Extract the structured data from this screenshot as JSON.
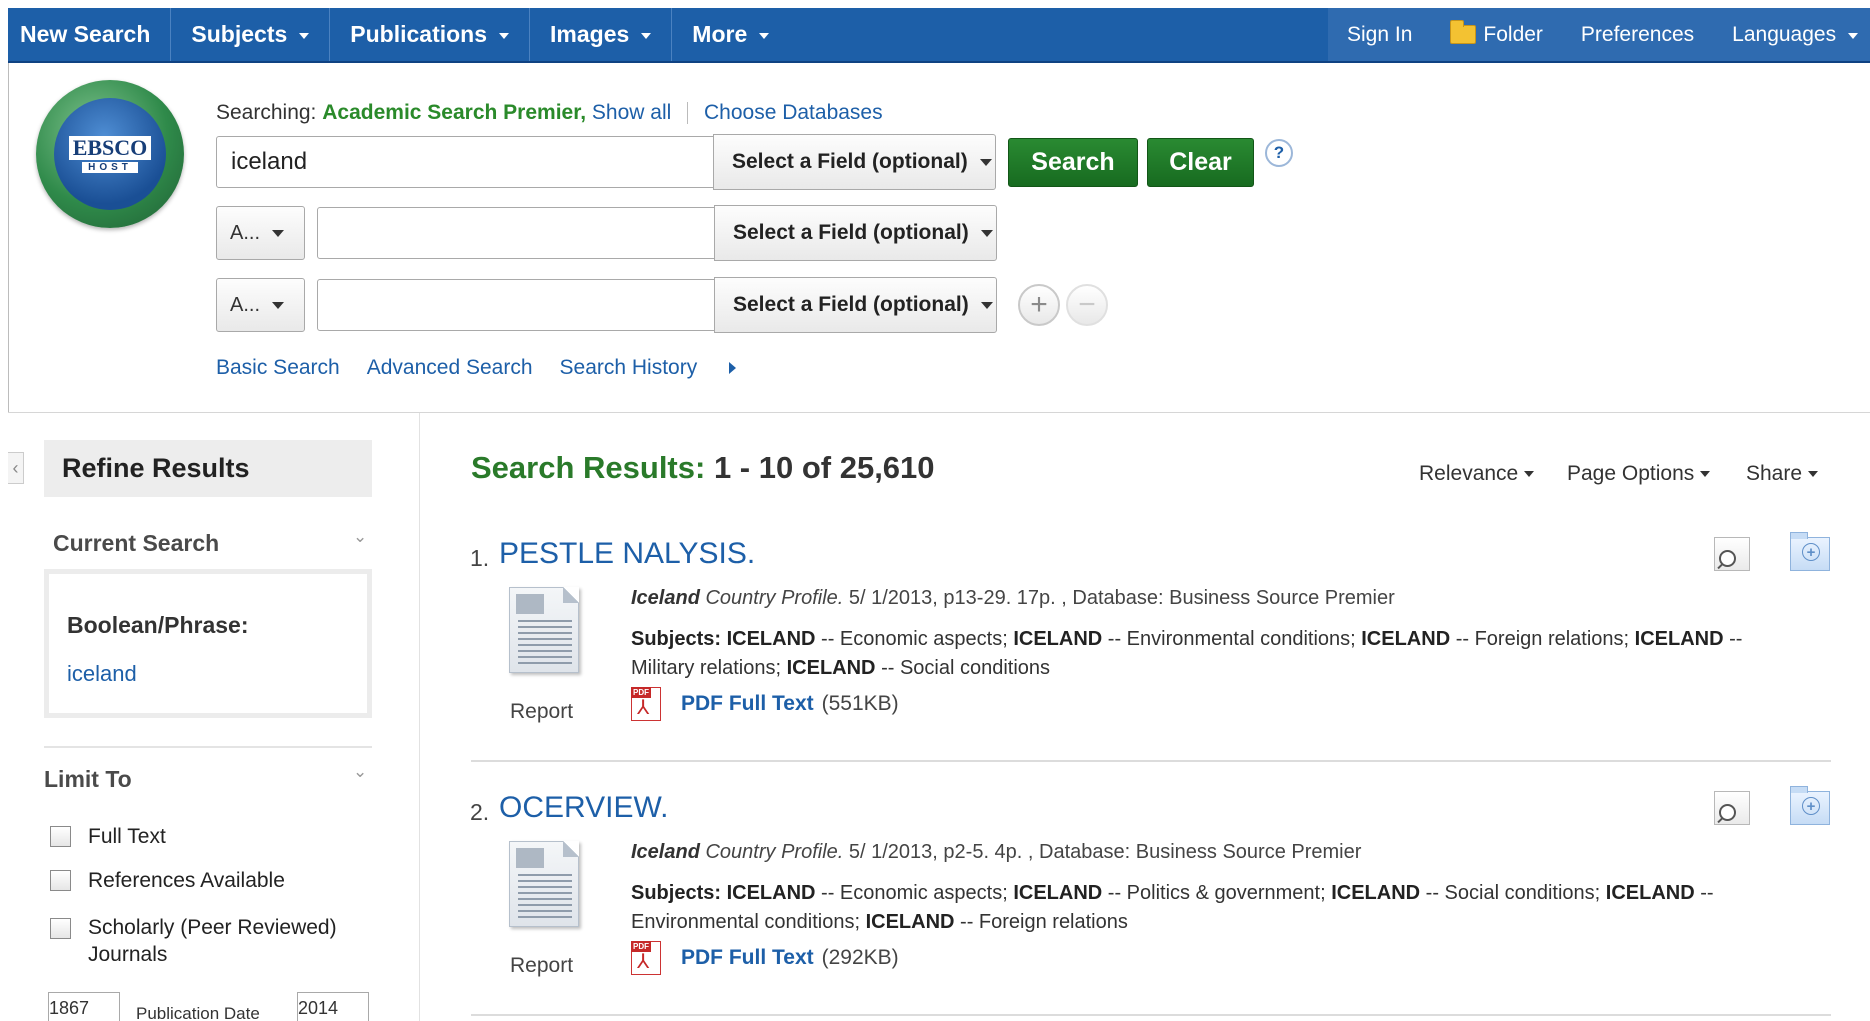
{
  "nav": {
    "items": [
      {
        "label": "New Search",
        "dropdown": false
      },
      {
        "label": "Subjects",
        "dropdown": true
      },
      {
        "label": "Publications",
        "dropdown": true
      },
      {
        "label": "Images",
        "dropdown": true
      },
      {
        "label": "More",
        "dropdown": true
      }
    ],
    "utility": {
      "sign_in": "Sign In",
      "folder": "Folder",
      "preferences": "Preferences",
      "languages": "Languages"
    }
  },
  "logo": {
    "word": "EBSCO",
    "sub": "HOST"
  },
  "search": {
    "searching_label": "Searching:",
    "database": "Academic Search Premier,",
    "show_all": "Show all",
    "choose_databases": "Choose Databases",
    "rows": [
      {
        "value": "iceland",
        "field": "Select a Field (optional)"
      },
      {
        "operator": "A...",
        "value": "",
        "field": "Select a Field (optional)"
      },
      {
        "operator": "A...",
        "value": "",
        "field": "Select a Field (optional)"
      }
    ],
    "search_button": "Search",
    "clear_button": "Clear",
    "help": "?",
    "links": {
      "basic": "Basic Search",
      "advanced": "Advanced Search",
      "history": "Search History"
    }
  },
  "refine": {
    "title": "Refine Results",
    "current_search": {
      "title": "Current Search",
      "label": "Boolean/Phrase:",
      "value": "iceland"
    },
    "limit_to": {
      "title": "Limit To",
      "options": [
        {
          "label": "Full Text",
          "checked": false
        },
        {
          "label": "References Available",
          "checked": false
        },
        {
          "label": "Scholarly (Peer Reviewed) Journals",
          "checked": false
        }
      ],
      "date_from": "1867",
      "date_label": "Publication Date",
      "date_to": "2014"
    }
  },
  "results": {
    "heading": "Search Results:",
    "range": "1 - 10 of 25,610",
    "tools": {
      "sort": "Relevance",
      "page_options": "Page Options",
      "share": "Share"
    },
    "items": [
      {
        "num": "1.",
        "title": "PESTLE NALYSIS.",
        "type": "Report",
        "cite_bold": "Iceland",
        "cite_italic": "Country Profile.",
        "cite_rest": "5/ 1/2013, p13-29. 17p. , Database: Business Source Premier",
        "subjects_label": "Subjects:",
        "subjects": [
          {
            "term": "ICELAND",
            "sub": "-- Economic aspects;"
          },
          {
            "term": "ICELAND",
            "sub": "-- Environmental conditions;"
          },
          {
            "term": "ICELAND",
            "sub": "-- Foreign relations;"
          },
          {
            "term": "ICELAND",
            "sub": "-- Military relations;"
          },
          {
            "term": "ICELAND",
            "sub": "-- Social conditions"
          }
        ],
        "pdf_label": "PDF Full Text",
        "pdf_size": "(551KB)"
      },
      {
        "num": "2.",
        "title": "OCERVIEW.",
        "type": "Report",
        "cite_bold": "Iceland",
        "cite_italic": "Country Profile.",
        "cite_rest": "5/ 1/2013, p2-5. 4p. , Database: Business Source Premier",
        "subjects_label": "Subjects:",
        "subjects": [
          {
            "term": "ICELAND",
            "sub": "-- Economic aspects;"
          },
          {
            "term": "ICELAND",
            "sub": "-- Politics & government;"
          },
          {
            "term": "ICELAND",
            "sub": "-- Social conditions;"
          },
          {
            "term": "ICELAND",
            "sub": "-- Environmental conditions;"
          },
          {
            "term": "ICELAND",
            "sub": "-- Foreign relations"
          }
        ],
        "pdf_label": "PDF Full Text",
        "pdf_size": "(292KB)"
      }
    ]
  }
}
